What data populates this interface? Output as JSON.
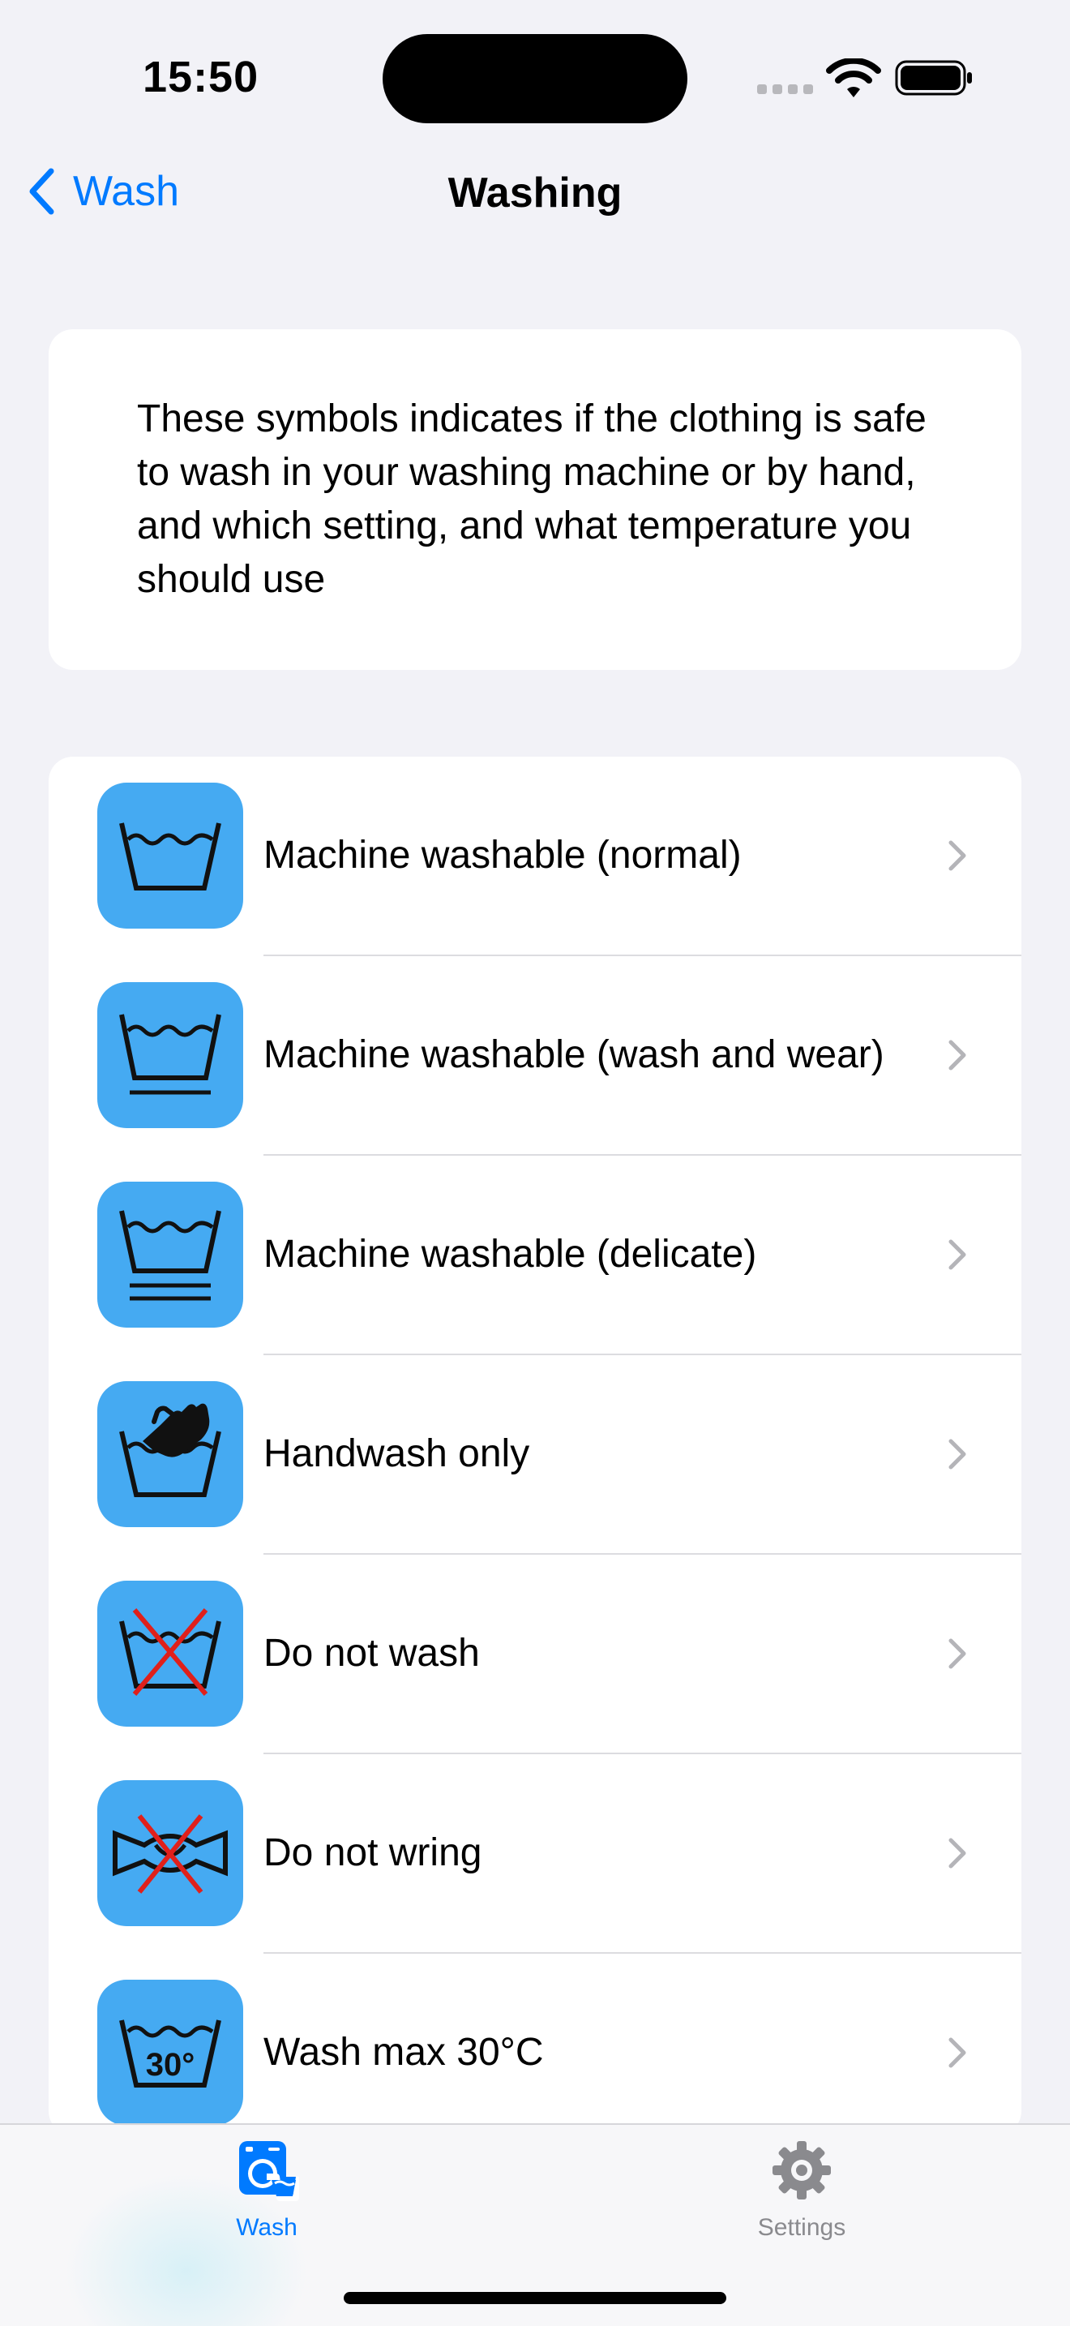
{
  "status_bar": {
    "time": "15:50",
    "icons": [
      "cellular-signal-icon",
      "wifi-icon",
      "battery-icon"
    ]
  },
  "nav": {
    "back_label": "Wash",
    "title": "Washing"
  },
  "intro": {
    "text": "These symbols indicates if the clothing is safe to wash in your washing machine or by hand, and which setting, and what temperature you should use"
  },
  "items": [
    {
      "label": "Machine washable (normal)",
      "icon": "wash-tub-icon"
    },
    {
      "label": "Machine washable (wash and wear)",
      "icon": "wash-tub-one-bar-icon"
    },
    {
      "label": "Machine washable (delicate)",
      "icon": "wash-tub-two-bars-icon"
    },
    {
      "label": "Handwash only",
      "icon": "hand-wash-icon"
    },
    {
      "label": "Do not wash",
      "icon": "do-not-wash-icon"
    },
    {
      "label": "Do not wring",
      "icon": "do-not-wring-icon"
    },
    {
      "label": "Wash max 30°C",
      "icon": "wash-30-icon",
      "icon_text": "30°"
    }
  ],
  "tabs": [
    {
      "label": "Wash",
      "icon": "washing-machine-icon",
      "selected": true
    },
    {
      "label": "Settings",
      "icon": "gear-icon",
      "selected": false
    }
  ],
  "colors": {
    "accent": "#007AFF",
    "icon_background": "#45AAF2",
    "cross": "#E0201B",
    "page_background": "#F2F2F7"
  }
}
